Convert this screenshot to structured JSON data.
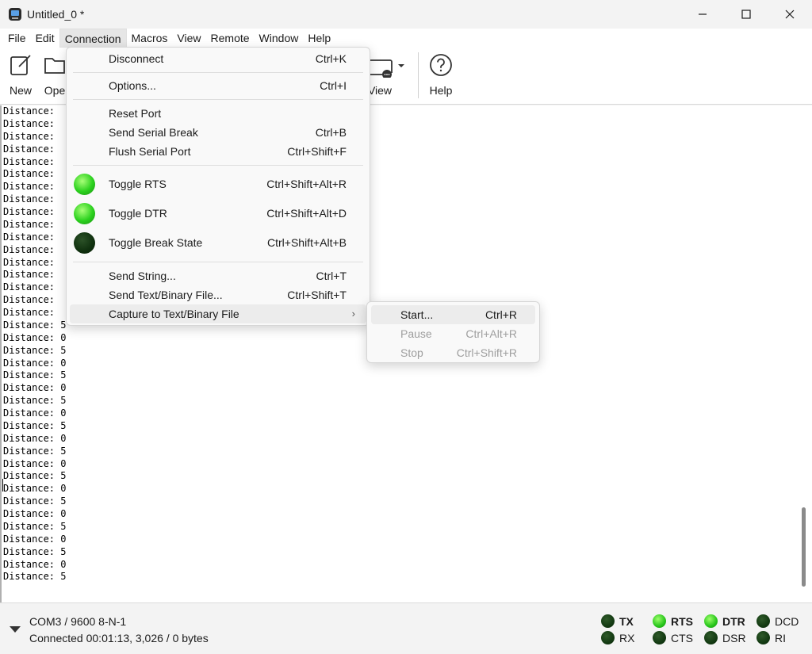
{
  "window": {
    "title": "Untitled_0 *"
  },
  "menubar": [
    "File",
    "Edit",
    "Connection",
    "Macros",
    "View",
    "Remote",
    "Window",
    "Help"
  ],
  "toolbar": {
    "new_label": "New",
    "open_label": "Ope",
    "view_label": "View",
    "help_label": "Help"
  },
  "terminal": {
    "lines": [
      "Distance: ",
      "Distance: ",
      "Distance: ",
      "Distance: ",
      "Distance: ",
      "Distance: ",
      "Distance: ",
      "Distance: ",
      "Distance: ",
      "Distance: ",
      "Distance: ",
      "Distance: ",
      "Distance: ",
      "Distance: ",
      "Distance: ",
      "Distance: ",
      "Distance: ",
      "Distance: 5",
      "Distance: 0",
      "Distance: 5",
      "Distance: 0",
      "Distance: 5",
      "Distance: 0",
      "Distance: 5",
      "Distance: 0",
      "Distance: 5",
      "Distance: 0",
      "Distance: 5",
      "Distance: 0",
      "Distance: 5",
      "Distance: 0",
      "Distance: 5",
      "Distance: 0",
      "Distance: 5",
      "Distance: 0",
      "Distance: 5",
      "Distance: 0",
      "Distance: 5"
    ]
  },
  "connection_menu": {
    "disconnect": {
      "label": "Disconnect",
      "shortcut": "Ctrl+K"
    },
    "options": {
      "label": "Options...",
      "shortcut": "Ctrl+I"
    },
    "reset_port": {
      "label": "Reset Port",
      "shortcut": ""
    },
    "send_break": {
      "label": "Send Serial Break",
      "shortcut": "Ctrl+B"
    },
    "flush": {
      "label": "Flush Serial Port",
      "shortcut": "Ctrl+Shift+F"
    },
    "toggle_rts": {
      "label": "Toggle RTS",
      "shortcut": "Ctrl+Shift+Alt+R"
    },
    "toggle_dtr": {
      "label": "Toggle DTR",
      "shortcut": "Ctrl+Shift+Alt+D"
    },
    "toggle_break": {
      "label": "Toggle Break State",
      "shortcut": "Ctrl+Shift+Alt+B"
    },
    "send_string": {
      "label": "Send String...",
      "shortcut": "Ctrl+T"
    },
    "send_file": {
      "label": "Send Text/Binary File...",
      "shortcut": "Ctrl+Shift+T"
    },
    "capture": {
      "label": "Capture to Text/Binary File",
      "shortcut": ""
    }
  },
  "capture_submenu": {
    "start": {
      "label": "Start...",
      "shortcut": "Ctrl+R"
    },
    "pause": {
      "label": "Pause",
      "shortcut": "Ctrl+Alt+R"
    },
    "stop": {
      "label": "Stop",
      "shortcut": "Ctrl+Shift+R"
    }
  },
  "status": {
    "port": "COM3 / 9600 8-N-1",
    "connection": "Connected 00:01:13, 3,026 / 0 bytes",
    "signals": {
      "tx": "TX",
      "rx": "RX",
      "rts": "RTS",
      "cts": "CTS",
      "dtr": "DTR",
      "dsr": "DSR",
      "dcd": "DCD",
      "ri": "RI"
    }
  },
  "colors": {
    "led_on": "#26c41a",
    "led_off": "#133a12",
    "menu_highlight": "#ececec"
  }
}
